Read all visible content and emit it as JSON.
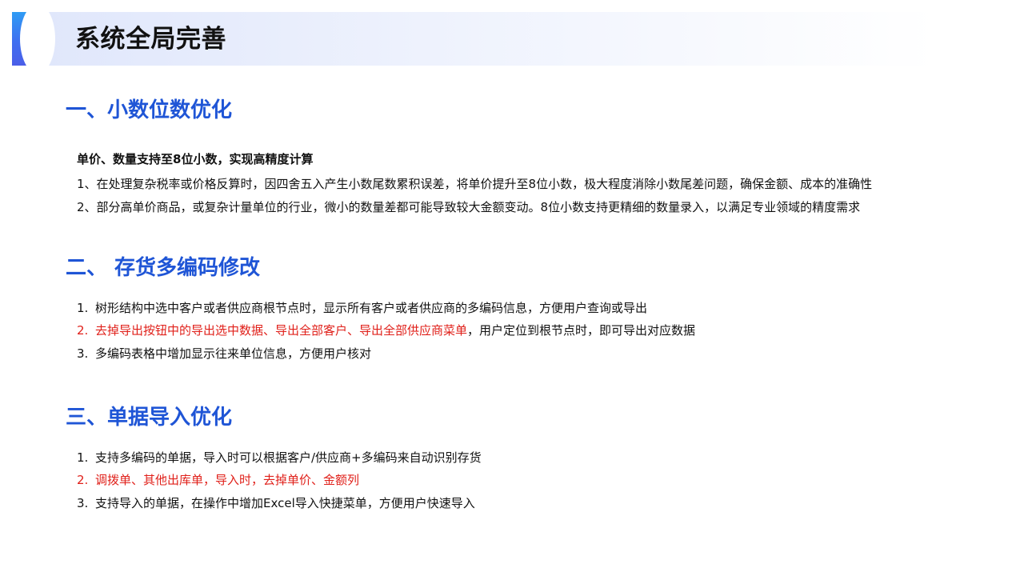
{
  "title": "系统全局完善",
  "sections": [
    {
      "heading": "一、小数位数优化",
      "subheading": "单价、数量支持至8位小数，实现高精度计算",
      "items": [
        {
          "text": "1、在处理复杂税率或价格反算时，因四舍五入产生小数尾数累积误差，将单价提升至8位小数，极大程度消除小数尾差问题，确保金额、成本的准确性"
        },
        {
          "text": "2、部分高单价商品，或复杂计量单位的行业，微小的数量差都可能导致较大金额变动。8位小数支持更精细的数量录入，以满足专业领域的精度需求"
        }
      ]
    },
    {
      "heading": "二、 存货多编码修改",
      "items": [
        {
          "number": "1.",
          "text": "树形结构中选中客户或者供应商根节点时，显示所有客户或者供应商的多编码信息，方便用户查询或导出"
        },
        {
          "number": "2.",
          "text_red": "去掉导出按钮中的导出选中数据、导出全部客户、导出全部供应商菜单",
          "text": "，用户定位到根节点时，即可导出对应数据"
        },
        {
          "number": "3.",
          "text": "多编码表格中增加显示往来单位信息，方便用户核对"
        }
      ]
    },
    {
      "heading": "三、单据导入优化",
      "items": [
        {
          "number": "1.",
          "text": "支持多编码的单据，导入时可以根据客户/供应商+多编码来自动识别存货"
        },
        {
          "number": "2.",
          "text_red": "调拨单、其他出库单，导入时，去掉单价、金额列"
        },
        {
          "number": "3.",
          "text": "支持导入的单据，在操作中增加Excel导入快捷菜单，方便用户快速导入"
        }
      ]
    }
  ],
  "colors": {
    "heading_blue": "#1f55d6",
    "highlight_red": "#e0201a",
    "body_text": "#111111"
  }
}
